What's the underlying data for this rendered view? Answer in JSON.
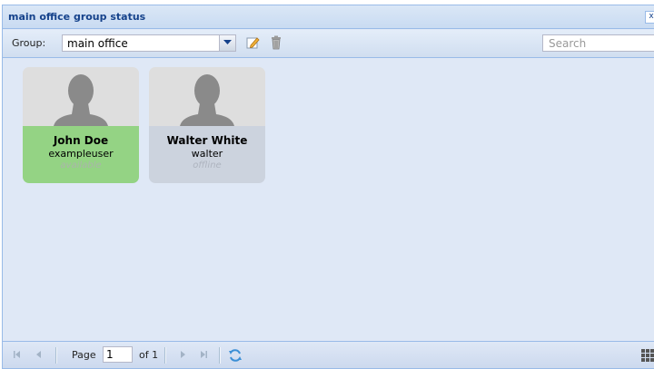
{
  "panel": {
    "title": "main office group status",
    "close_symbol": "x"
  },
  "toolbar": {
    "group_label": "Group:",
    "group_value": "main office",
    "search_placeholder": "Search"
  },
  "users": [
    {
      "name": "John Doe",
      "username": "exampleuser",
      "status": "available"
    },
    {
      "name": "Walter White",
      "username": "walter",
      "status": "offline"
    }
  ],
  "paging": {
    "page_label": "Page",
    "page_value": "1",
    "of_label": "of 1"
  },
  "colors": {
    "available": "#94d384",
    "offline": "#ccd3de",
    "header_text": "#15428b"
  },
  "icons": [
    "first-page-icon",
    "prev-page-icon",
    "next-page-icon",
    "last-page-icon",
    "refresh-icon",
    "edit-icon",
    "trash-icon",
    "grid-icon"
  ]
}
